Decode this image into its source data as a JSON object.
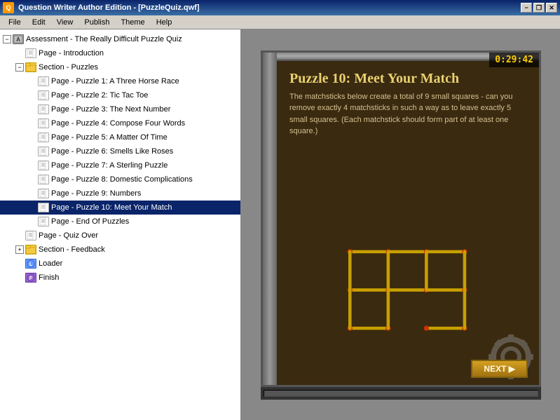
{
  "titlebar": {
    "icon": "Q",
    "title": "Question Writer Author Edition - [PuzzleQuiz.qwf]",
    "min": "−",
    "restore": "❐",
    "close": "✕"
  },
  "menubar": {
    "items": [
      "File",
      "Edit",
      "View",
      "Publish",
      "Theme",
      "Help"
    ]
  },
  "tree": {
    "nodes": [
      {
        "id": "assessment",
        "indent": 0,
        "expand": "−",
        "iconType": "assessment",
        "label": "Assessment - The Really Difficult Puzzle Quiz",
        "selected": false
      },
      {
        "id": "page-intro",
        "indent": 1,
        "expand": null,
        "iconType": "page",
        "label": "Page - Introduction",
        "selected": false
      },
      {
        "id": "section-puzzles",
        "indent": 1,
        "expand": "−",
        "iconType": "section-open",
        "label": "Section - Puzzles",
        "selected": false
      },
      {
        "id": "page-p1",
        "indent": 2,
        "expand": null,
        "iconType": "page",
        "label": "Page - Puzzle 1: A Three Horse Race",
        "selected": false
      },
      {
        "id": "page-p2",
        "indent": 2,
        "expand": null,
        "iconType": "page",
        "label": "Page - Puzzle 2: Tic Tac Toe",
        "selected": false
      },
      {
        "id": "page-p3",
        "indent": 2,
        "expand": null,
        "iconType": "page",
        "label": "Page - Puzzle 3: The Next Number",
        "selected": false
      },
      {
        "id": "page-p4",
        "indent": 2,
        "expand": null,
        "iconType": "page",
        "label": "Page - Puzzle 4: Compose Four Words",
        "selected": false
      },
      {
        "id": "page-p5",
        "indent": 2,
        "expand": null,
        "iconType": "page",
        "label": "Page - Puzzle 5: A Matter Of Time",
        "selected": false
      },
      {
        "id": "page-p6",
        "indent": 2,
        "expand": null,
        "iconType": "page",
        "label": "Page - Puzzle 6: Smells Like Roses",
        "selected": false
      },
      {
        "id": "page-p7",
        "indent": 2,
        "expand": null,
        "iconType": "page",
        "label": "Page - Puzzle 7: A Sterling Puzzle",
        "selected": false
      },
      {
        "id": "page-p8",
        "indent": 2,
        "expand": null,
        "iconType": "page",
        "label": "Page - Puzzle 8: Domestic Complications",
        "selected": false
      },
      {
        "id": "page-p9",
        "indent": 2,
        "expand": null,
        "iconType": "page",
        "label": "Page - Puzzle 9: Numbers",
        "selected": false
      },
      {
        "id": "page-p10",
        "indent": 2,
        "expand": null,
        "iconType": "page",
        "label": "Page - Puzzle 10: Meet Your Match",
        "selected": true
      },
      {
        "id": "page-end",
        "indent": 2,
        "expand": null,
        "iconType": "page",
        "label": "Page - End Of Puzzles",
        "selected": false
      },
      {
        "id": "page-quiz-over",
        "indent": 1,
        "expand": null,
        "iconType": "page",
        "label": "Page - Quiz Over",
        "selected": false
      },
      {
        "id": "section-feedback",
        "indent": 1,
        "expand": "+",
        "iconType": "section-closed",
        "label": "Section - Feedback",
        "selected": false
      },
      {
        "id": "loader",
        "indent": 1,
        "expand": null,
        "iconType": "loader",
        "label": "Loader",
        "selected": false
      },
      {
        "id": "finish",
        "indent": 1,
        "expand": null,
        "iconType": "finish",
        "label": "Finish",
        "selected": false
      }
    ]
  },
  "preview": {
    "timer": "0:29:42",
    "puzzle_title": "Puzzle 10: Meet Your Match",
    "puzzle_desc": "The matchsticks below create a total of 9 small squares - can you remove exactly 4 matchsticks in such a way as to leave exactly 5 small squares. (Each matchstick should form part of at least one square.)",
    "next_label": "NEXT ▶"
  }
}
